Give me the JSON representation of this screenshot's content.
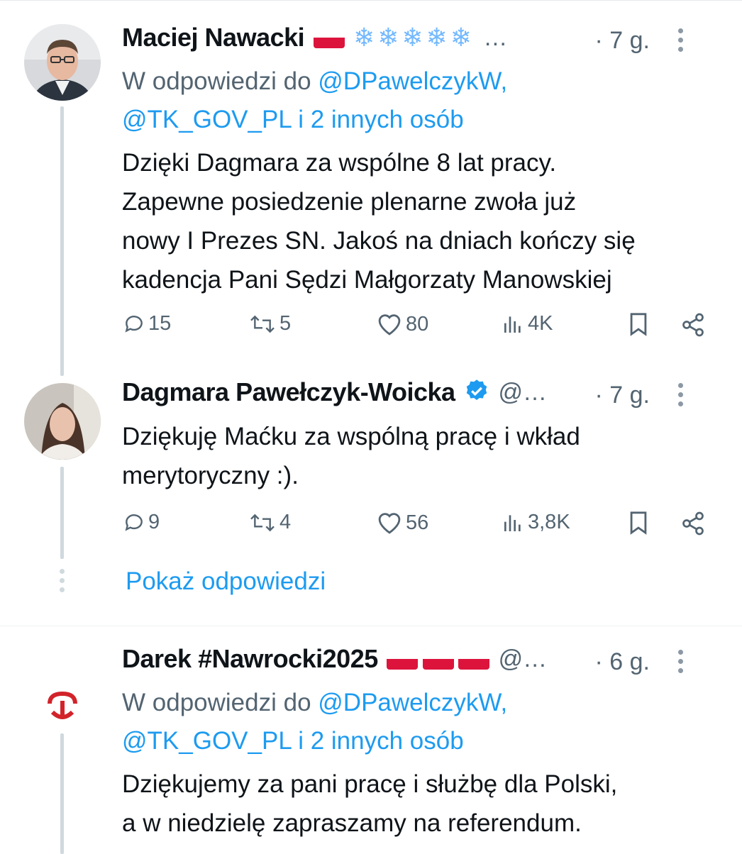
{
  "tweets": [
    {
      "author": "Maciej Nawacki",
      "badges": [
        "flag-pl",
        "snowflake",
        "snowflake",
        "snowflake",
        "snowflake",
        "snowflake"
      ],
      "handle_truncated": "…",
      "time": "· 7 g.",
      "reply_prefix": "W odpowiedzi do ",
      "reply_mention_1": "@DPawelczykW,",
      "reply_mention_2": "@TK_GOV_PL i 2 innych osób",
      "text_lines": [
        "Dzięki Dagmara za wspólne 8 lat pracy.",
        "Zapewne posiedzenie plenarne zwoła już",
        "nowy I Prezes SN. Jakoś na dniach kończy się",
        "kadencja Pani Sędzi Małgorzaty Manowskiej"
      ],
      "stats": {
        "replies": "15",
        "reposts": "5",
        "likes": "80",
        "views": "4K"
      }
    },
    {
      "author": "Dagmara Pawełczyk-Woicka",
      "verified": true,
      "handle_truncated": "@…",
      "time": "· 7 g.",
      "text_lines": [
        "Dziękuję Maćku za wspólną pracę i wkład",
        "merytoryczny :)."
      ],
      "stats": {
        "replies": "9",
        "reposts": "4",
        "likes": "56",
        "views": "3,8K"
      }
    },
    {
      "author": "Darek #Nawrocki2025",
      "badges": [
        "flag-pl",
        "flag-pl",
        "flag-pl"
      ],
      "handle_truncated": "@…",
      "time": "· 6 g.",
      "reply_prefix": "W odpowiedzi do ",
      "reply_mention_1": "@DPawelczykW,",
      "reply_mention_2": "@TK_GOV_PL i 2 innych osób",
      "text_lines": [
        "Dziękujemy za pani pracę i służbę dla Polski,",
        "a w niedzielę zapraszamy na referendum."
      ]
    }
  ],
  "show_replies_label": "Pokaż odpowiedzi",
  "colors": {
    "accent": "#1d9bf0",
    "muted": "#536471",
    "text": "#0f1419"
  }
}
